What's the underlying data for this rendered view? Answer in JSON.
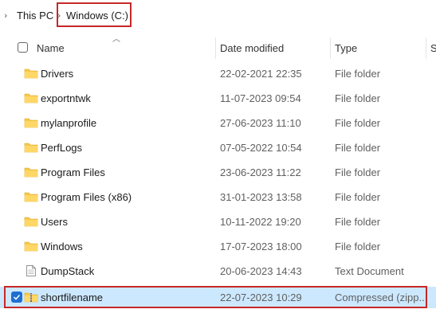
{
  "breadcrumb": {
    "items": [
      {
        "label": "This PC"
      },
      {
        "label": "Windows (C:)"
      }
    ]
  },
  "columns": {
    "name": "Name",
    "date_modified": "Date modified",
    "type": "Type",
    "size": "S"
  },
  "rows": [
    {
      "name": "Drivers",
      "date": "22-02-2021 22:35",
      "type": "File folder",
      "icon": "folder-icon"
    },
    {
      "name": "exportntwk",
      "date": "11-07-2023 09:54",
      "type": "File folder",
      "icon": "folder-icon"
    },
    {
      "name": "mylanprofile",
      "date": "27-06-2023 11:10",
      "type": "File folder",
      "icon": "folder-icon"
    },
    {
      "name": "PerfLogs",
      "date": "07-05-2022 10:54",
      "type": "File folder",
      "icon": "folder-icon"
    },
    {
      "name": "Program Files",
      "date": "23-06-2023 11:22",
      "type": "File folder",
      "icon": "folder-icon"
    },
    {
      "name": "Program Files (x86)",
      "date": "31-01-2023 13:58",
      "type": "File folder",
      "icon": "folder-icon"
    },
    {
      "name": "Users",
      "date": "10-11-2022 19:20",
      "type": "File folder",
      "icon": "folder-icon"
    },
    {
      "name": "Windows",
      "date": "17-07-2023 18:00",
      "type": "File folder",
      "icon": "folder-icon"
    },
    {
      "name": "DumpStack",
      "date": "20-06-2023 14:43",
      "type": "Text Document",
      "icon": "text-document-icon"
    },
    {
      "name": "shortfilename",
      "date": "22-07-2023 10:29",
      "type": "Compressed (zipp...",
      "icon": "zip-folder-icon",
      "selected": true
    }
  ],
  "colors": {
    "folder": "#f8c948",
    "selection": "#cce8ff",
    "highlight": "#c62828",
    "checkbox": "#1f6fd0"
  }
}
